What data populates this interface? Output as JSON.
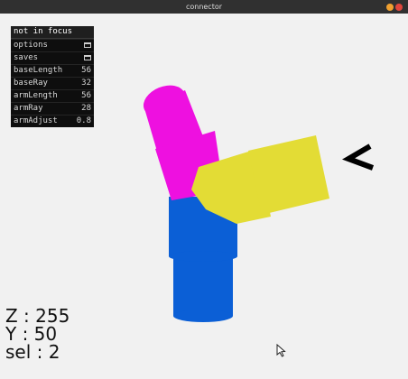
{
  "window": {
    "title": "connector",
    "minimize_color": "#f0a030",
    "close_color": "#e0463d"
  },
  "panel": {
    "header": "not in focus",
    "folders": [
      {
        "label": "options",
        "icon": "folder-icon"
      },
      {
        "label": "saves",
        "icon": "folder-icon"
      }
    ],
    "params": [
      {
        "label": "baseLength",
        "value": "56"
      },
      {
        "label": "baseRay",
        "value": "32"
      },
      {
        "label": "armLength",
        "value": "56"
      },
      {
        "label": "armRay",
        "value": "28"
      },
      {
        "label": "armAdjust",
        "value": "0.8"
      }
    ]
  },
  "scene": {
    "colors": {
      "base": "#0b5fd6",
      "arm_upper": "#ee10e0",
      "arm_right": "#e3dc35",
      "pointer": "#000000"
    }
  },
  "hud": {
    "z": "Z : 255",
    "y": "Y : 50",
    "sel": "sel : 2"
  }
}
